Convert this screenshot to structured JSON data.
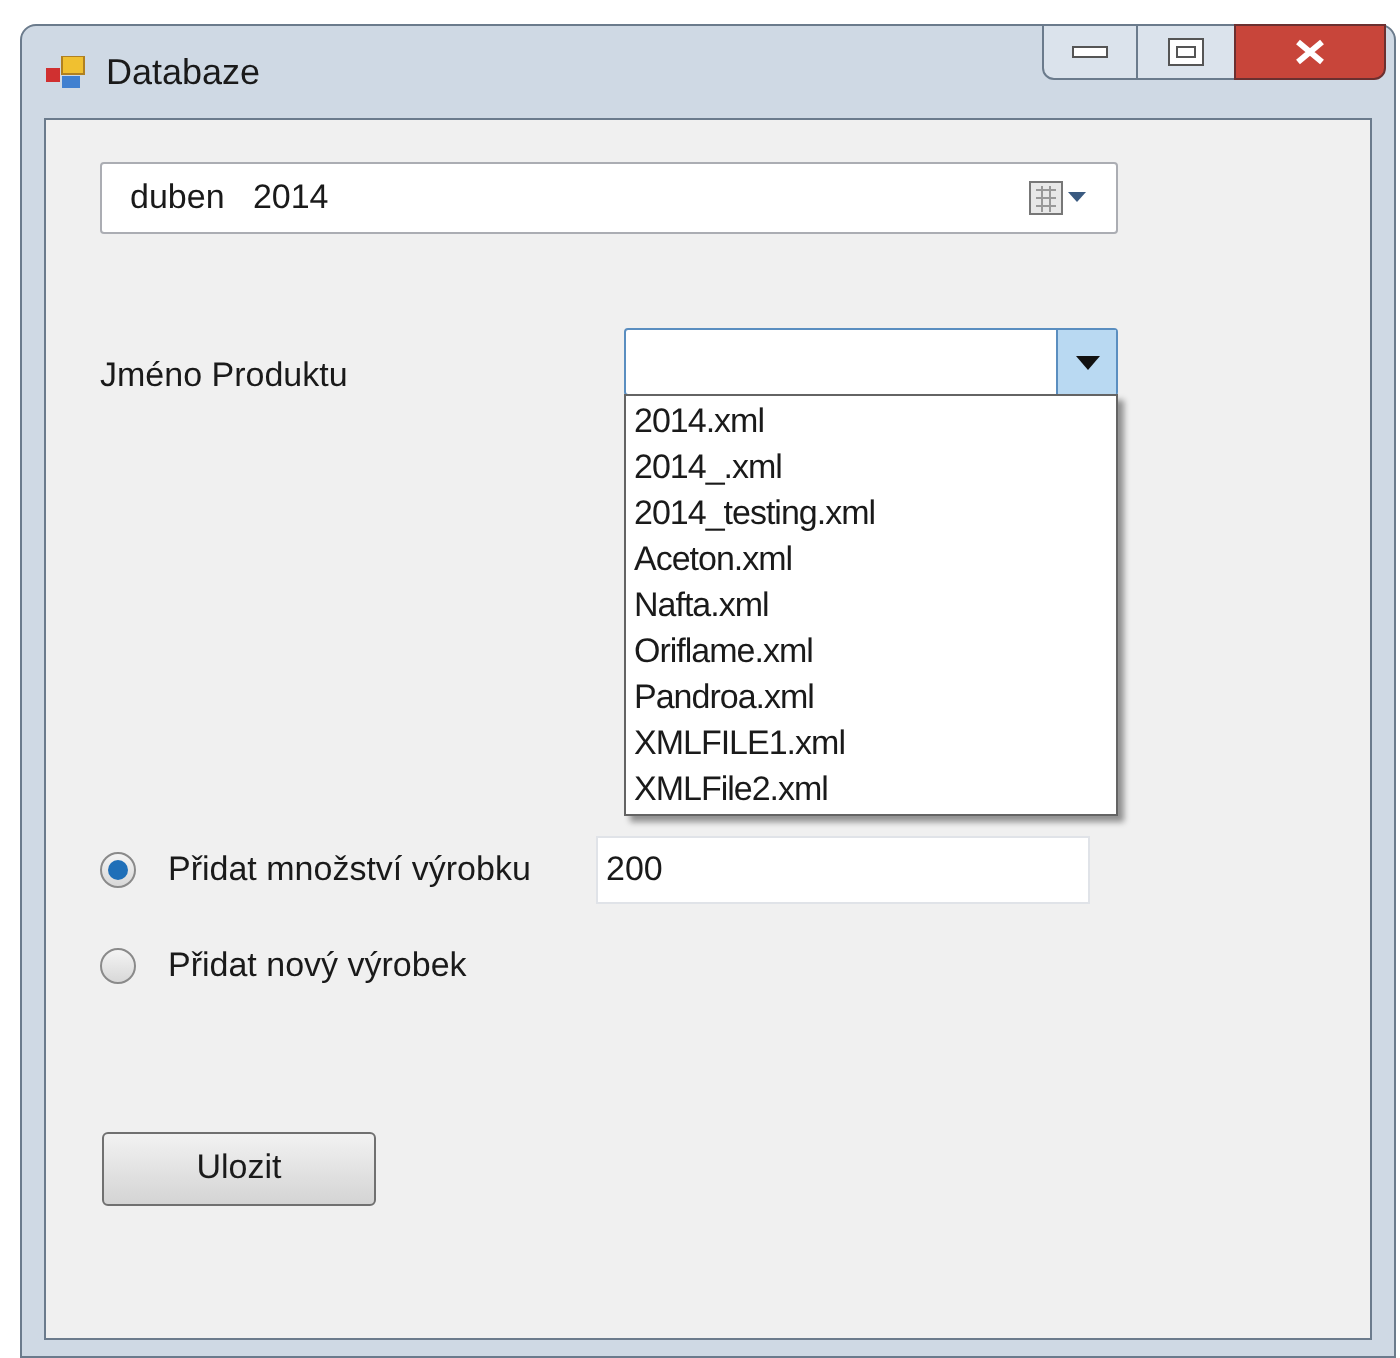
{
  "window": {
    "title": "Databaze"
  },
  "date_picker": {
    "value": "duben   2014"
  },
  "product": {
    "label": "Jméno Produktu",
    "expanded": true,
    "options": [
      "2014.xml",
      "2014_.xml",
      "2014_testing.xml",
      "Aceton.xml",
      "Nafta.xml",
      "Oriflame.xml",
      "Pandroa.xml",
      "XMLFILE1.xml",
      "XMLFile2.xml"
    ]
  },
  "radios": [
    {
      "label": "Přidat množství výrobku",
      "selected": true
    },
    {
      "label": "Přidat nový výrobek",
      "selected": false
    }
  ],
  "quantity": {
    "value": "200"
  },
  "buttons": [
    "Ulozit"
  ]
}
